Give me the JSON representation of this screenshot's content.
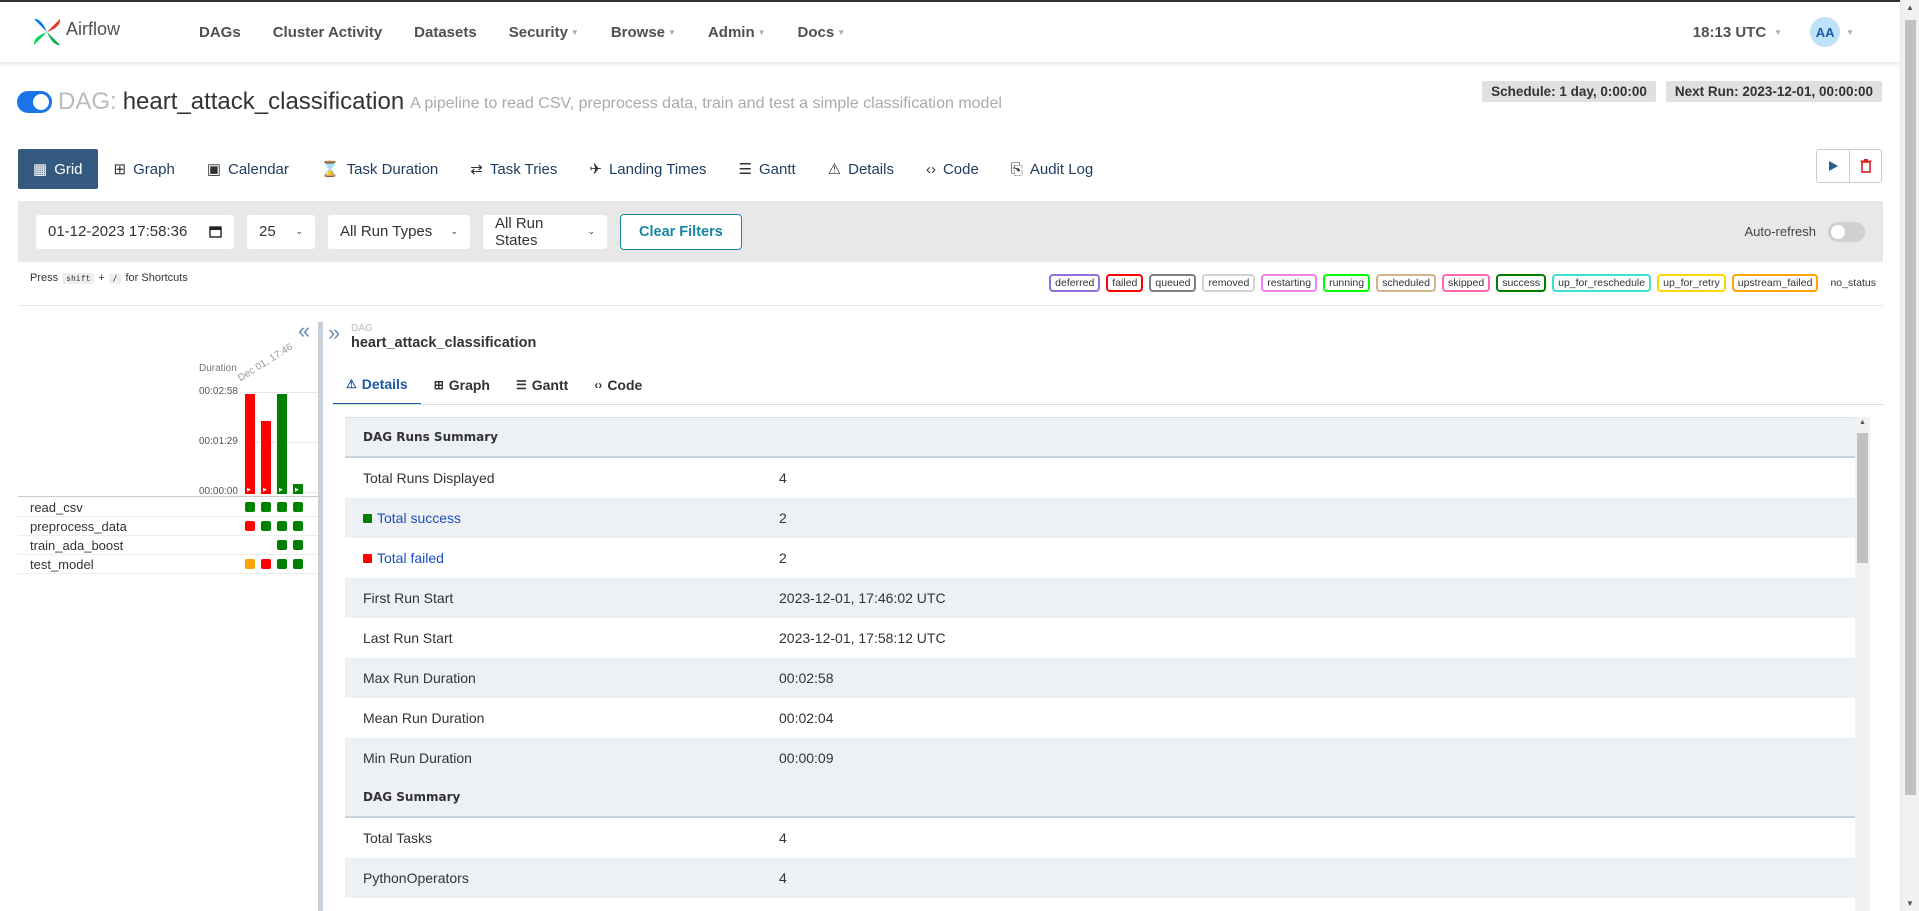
{
  "app": {
    "name": "Airflow"
  },
  "nav": {
    "items": [
      {
        "label": "DAGs",
        "dropdown": false
      },
      {
        "label": "Cluster Activity",
        "dropdown": false
      },
      {
        "label": "Datasets",
        "dropdown": false
      },
      {
        "label": "Security",
        "dropdown": true
      },
      {
        "label": "Browse",
        "dropdown": true
      },
      {
        "label": "Admin",
        "dropdown": true
      },
      {
        "label": "Docs",
        "dropdown": true
      }
    ],
    "clock": "18:13 UTC",
    "avatar": "AA"
  },
  "dag": {
    "prefix": "DAG:",
    "id": "heart_attack_classification",
    "description": "A pipeline to read CSV, preprocess data, train and test a simple classification model",
    "paused": false,
    "schedule": "Schedule: 1 day, 0:00:00",
    "next_run": "Next Run: 2023-12-01, 00:00:00"
  },
  "view_tabs": [
    {
      "label": "Grid",
      "icon": "grid-icon",
      "active": true
    },
    {
      "label": "Graph",
      "icon": "graph-icon"
    },
    {
      "label": "Calendar",
      "icon": "calendar-icon"
    },
    {
      "label": "Task Duration",
      "icon": "hourglass-icon"
    },
    {
      "label": "Task Tries",
      "icon": "retry-icon"
    },
    {
      "label": "Landing Times",
      "icon": "landing-icon"
    },
    {
      "label": "Gantt",
      "icon": "gantt-icon"
    },
    {
      "label": "Details",
      "icon": "details-icon"
    },
    {
      "label": "Code",
      "icon": "code-icon"
    },
    {
      "label": "Audit Log",
      "icon": "audit-icon"
    }
  ],
  "filters": {
    "date": "01-12-2023  17:58:36",
    "num_runs": "25",
    "run_type": "All Run Types",
    "run_state": "All Run States",
    "clear_label": "Clear Filters",
    "autorefresh_label": "Auto-refresh"
  },
  "shortcuts": {
    "press": "Press",
    "key1": "shift",
    "plus": "+",
    "key2": "/",
    "suffix": "for Shortcuts"
  },
  "legend": [
    {
      "label": "deferred",
      "color": "#9370db"
    },
    {
      "label": "failed",
      "color": "#ff0000"
    },
    {
      "label": "queued",
      "color": "#808080"
    },
    {
      "label": "removed",
      "color": "#d3d3d3"
    },
    {
      "label": "restarting",
      "color": "#ee82ee"
    },
    {
      "label": "running",
      "color": "#00ff00"
    },
    {
      "label": "scheduled",
      "color": "#d2b48c"
    },
    {
      "label": "skipped",
      "color": "#ff69b4"
    },
    {
      "label": "success",
      "color": "#008000"
    },
    {
      "label": "up_for_reschedule",
      "color": "#40e0d0"
    },
    {
      "label": "up_for_retry",
      "color": "#ffd700"
    },
    {
      "label": "upstream_failed",
      "color": "#ffa500"
    },
    {
      "label": "no_status",
      "color": "transparent"
    }
  ],
  "grid": {
    "duration_label": "Duration",
    "date_label": "Dec 01, 17:46",
    "ticks": [
      "00:02:58",
      "00:01:29",
      "00:00:00"
    ],
    "runs": [
      {
        "state": "failed",
        "color": "#ff0000",
        "duration_fraction": 1.0
      },
      {
        "state": "failed",
        "color": "#ff0000",
        "duration_fraction": 0.73
      },
      {
        "state": "success",
        "color": "#008000",
        "duration_fraction": 1.0
      },
      {
        "state": "success",
        "color": "#008000",
        "duration_fraction": 0.09
      }
    ],
    "tasks": [
      {
        "name": "read_csv",
        "states": [
          "#008000",
          "#008000",
          "#008000",
          "#008000"
        ]
      },
      {
        "name": "preprocess_data",
        "states": [
          "#ff0000",
          "#008000",
          "#008000",
          "#008000"
        ]
      },
      {
        "name": "train_ada_boost",
        "states": [
          null,
          null,
          "#008000",
          "#008000"
        ]
      },
      {
        "name": "test_model",
        "states": [
          "#ffa500",
          "#ff0000",
          "#008000",
          "#008000"
        ]
      }
    ]
  },
  "detail": {
    "crumb_label": "DAG",
    "crumb": "heart_attack_classification",
    "tabs": [
      {
        "label": "Details",
        "icon": "details-icon",
        "active": true
      },
      {
        "label": "Graph",
        "icon": "graph-icon"
      },
      {
        "label": "Gantt",
        "icon": "gantt-icon"
      },
      {
        "label": "Code",
        "icon": "code-icon"
      }
    ],
    "rows": [
      {
        "type": "section",
        "label": "DAG Runs Summary"
      },
      {
        "label": "Total Runs Displayed",
        "value": "4"
      },
      {
        "label": "Total success",
        "value": "2",
        "link": true,
        "dot": "#008000"
      },
      {
        "label": "Total failed",
        "value": "2",
        "link": true,
        "dot": "#ff0000"
      },
      {
        "label": "First Run Start",
        "value": "2023-12-01, 17:46:02 UTC"
      },
      {
        "label": "Last Run Start",
        "value": "2023-12-01, 17:58:12 UTC"
      },
      {
        "label": "Max Run Duration",
        "value": "00:02:58"
      },
      {
        "label": "Mean Run Duration",
        "value": "00:02:04"
      },
      {
        "label": "Min Run Duration",
        "value": "00:00:09"
      },
      {
        "type": "section",
        "label": "DAG Summary"
      },
      {
        "label": "Total Tasks",
        "value": "4"
      },
      {
        "label": "PythonOperators",
        "value": "4"
      },
      {
        "label": "",
        "value": ""
      }
    ]
  }
}
